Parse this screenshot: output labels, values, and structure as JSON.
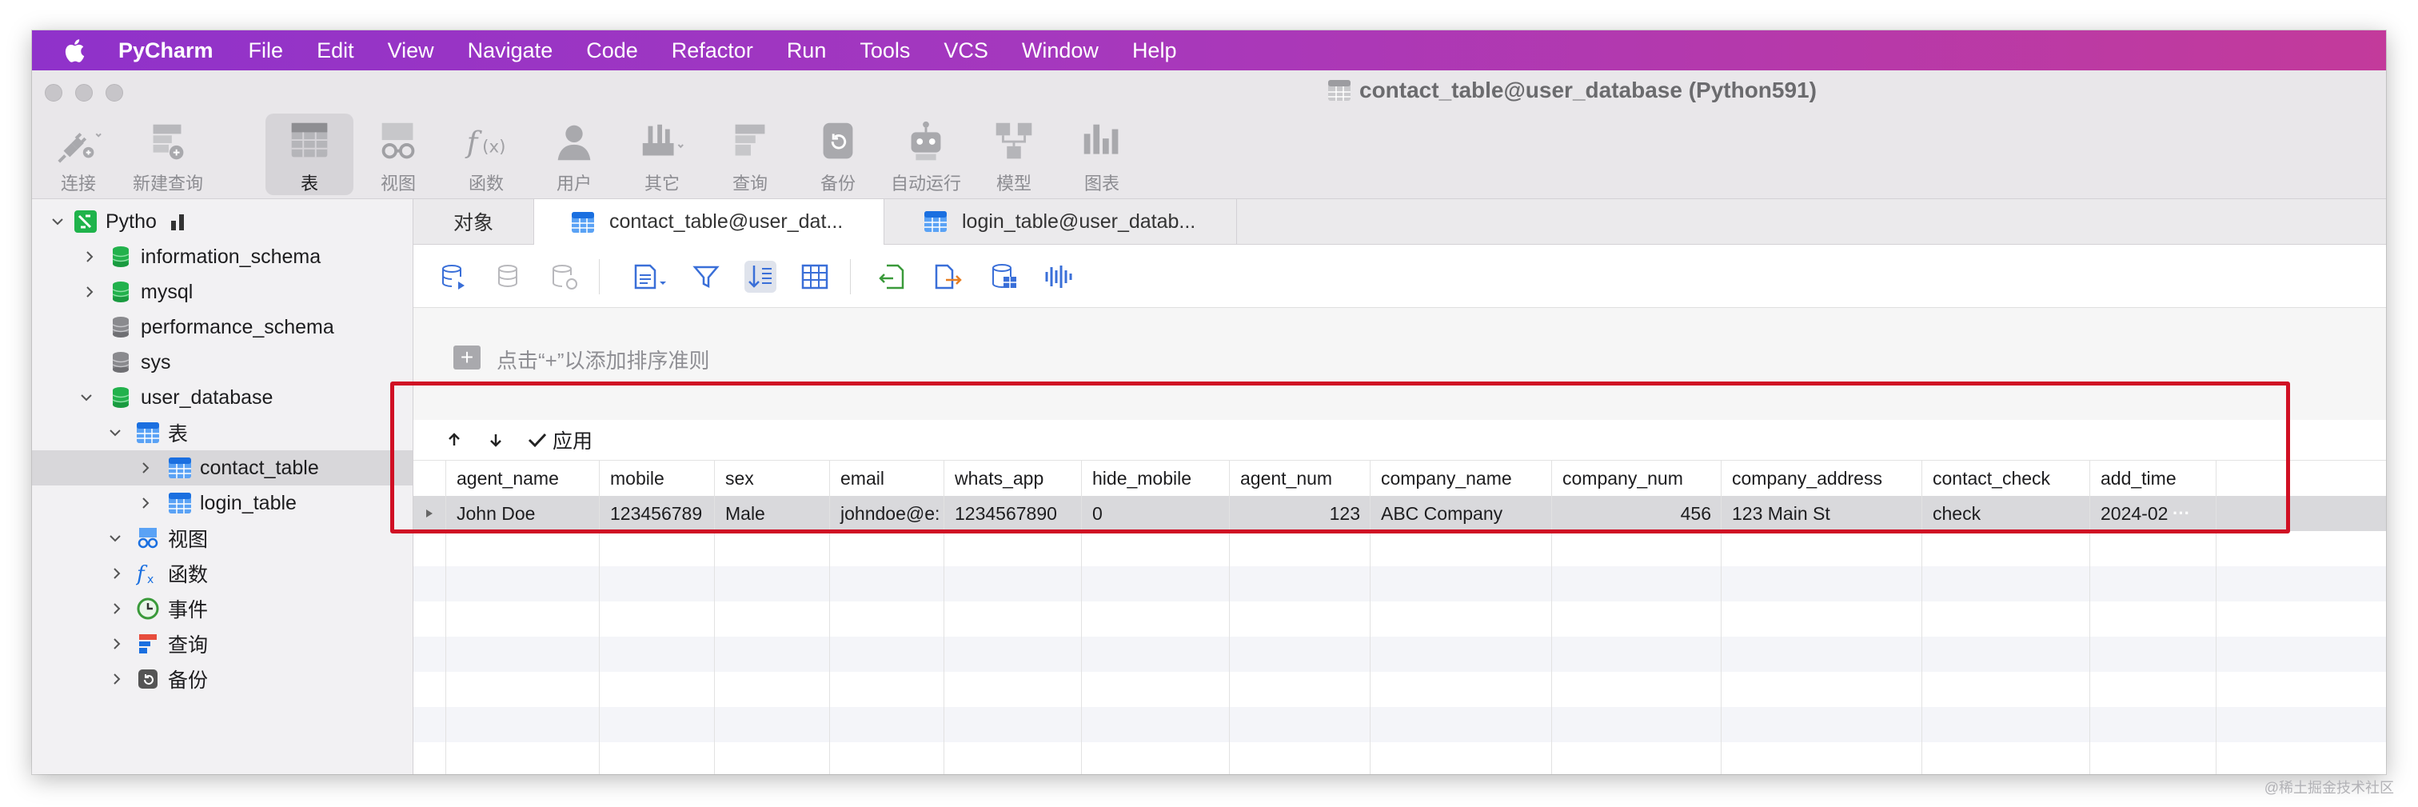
{
  "menubar": {
    "app": "PyCharm",
    "items": [
      "File",
      "Edit",
      "View",
      "Navigate",
      "Code",
      "Refactor",
      "Run",
      "Tools",
      "VCS",
      "Window",
      "Help"
    ]
  },
  "window": {
    "title": "contact_table@user_database (Python591)"
  },
  "toolbar": {
    "buttons": [
      {
        "label": "连接",
        "icon": "plug-icon"
      },
      {
        "label": "新建查询",
        "icon": "new-query-icon"
      },
      {
        "label": "表",
        "icon": "table-icon"
      },
      {
        "label": "视图",
        "icon": "view-glasses-icon"
      },
      {
        "label": "函数",
        "icon": "function-icon"
      },
      {
        "label": "用户",
        "icon": "user-icon"
      },
      {
        "label": "其它",
        "icon": "tools-icon"
      },
      {
        "label": "查询",
        "icon": "query-icon"
      },
      {
        "label": "备份",
        "icon": "backup-icon"
      },
      {
        "label": "自动运行",
        "icon": "robot-icon"
      },
      {
        "label": "模型",
        "icon": "model-icon"
      },
      {
        "label": "图表",
        "icon": "chart-icon"
      }
    ],
    "active": "表"
  },
  "sidebar": {
    "connection": "Pytho",
    "databases": [
      "information_schema",
      "mysql",
      "performance_schema",
      "sys",
      "user_database"
    ],
    "user_database": {
      "tables_group": "表",
      "tables": [
        "contact_table",
        "login_table"
      ],
      "groups": [
        "视图",
        "函数",
        "事件",
        "查询",
        "备份"
      ]
    }
  },
  "tabs": [
    {
      "label": "对象"
    },
    {
      "label": "contact_table@user_dat..."
    },
    {
      "label": "login_table@user_datab..."
    }
  ],
  "sort": {
    "hint": "点击“+”以添加排序准则"
  },
  "gridbar": {
    "apply": "应用"
  },
  "table": {
    "columns": [
      "agent_name",
      "mobile",
      "sex",
      "email",
      "whats_app",
      "hide_mobile",
      "agent_num",
      "company_name",
      "company_num",
      "company_address",
      "contact_check",
      "add_time"
    ],
    "rows": [
      [
        "John Doe",
        "123456789",
        "Male",
        "johndoe@e:",
        "1234567890",
        "0",
        "123",
        "ABC Company",
        "456",
        "123 Main St",
        "check",
        "2024-02"
      ]
    ],
    "overflow_marker": "···"
  },
  "colors": {
    "highlight_box": "#d01024",
    "menubar_start": "#8f32ca",
    "menubar_end": "#c33a9b"
  },
  "watermark": "@稀土掘金技术社区"
}
